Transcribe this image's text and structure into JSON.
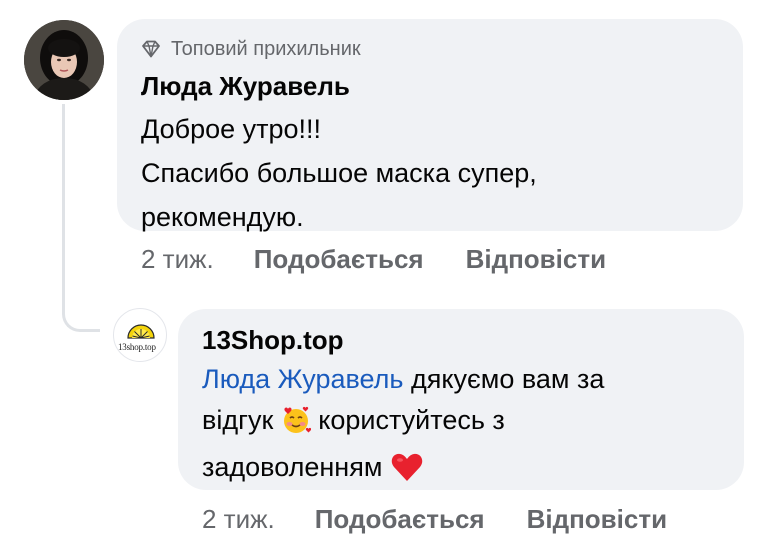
{
  "comment": {
    "badge": "Топовий прихильник",
    "author": "Люда Журавель",
    "lines": [
      "Доброе утро!!!",
      "Спасибо большое маска супер,",
      "рекомендую."
    ],
    "time": "2 тиж.",
    "like_label": "Подобається",
    "reply_label": "Відповісти",
    "badge_icon": "diamond-icon"
  },
  "reply": {
    "author": "13Shop.top",
    "avatar_text": "13shop.top",
    "mention": "Люда Журавель",
    "text_1": " дякуємо вам за",
    "text_2": "відгук",
    "text_3": " користуйтесь з",
    "text_4": "задоволенням",
    "emoji_1": "smiling-face-with-hearts",
    "emoji_2": "red-heart",
    "time": "2 тиж.",
    "like_label": "Подобається",
    "reply_label": "Відповісти"
  },
  "colors": {
    "bubble": "#f0f2f5",
    "secondary_text": "#65676b",
    "mention": "#1a5bbd",
    "heart": "#e8212e"
  }
}
